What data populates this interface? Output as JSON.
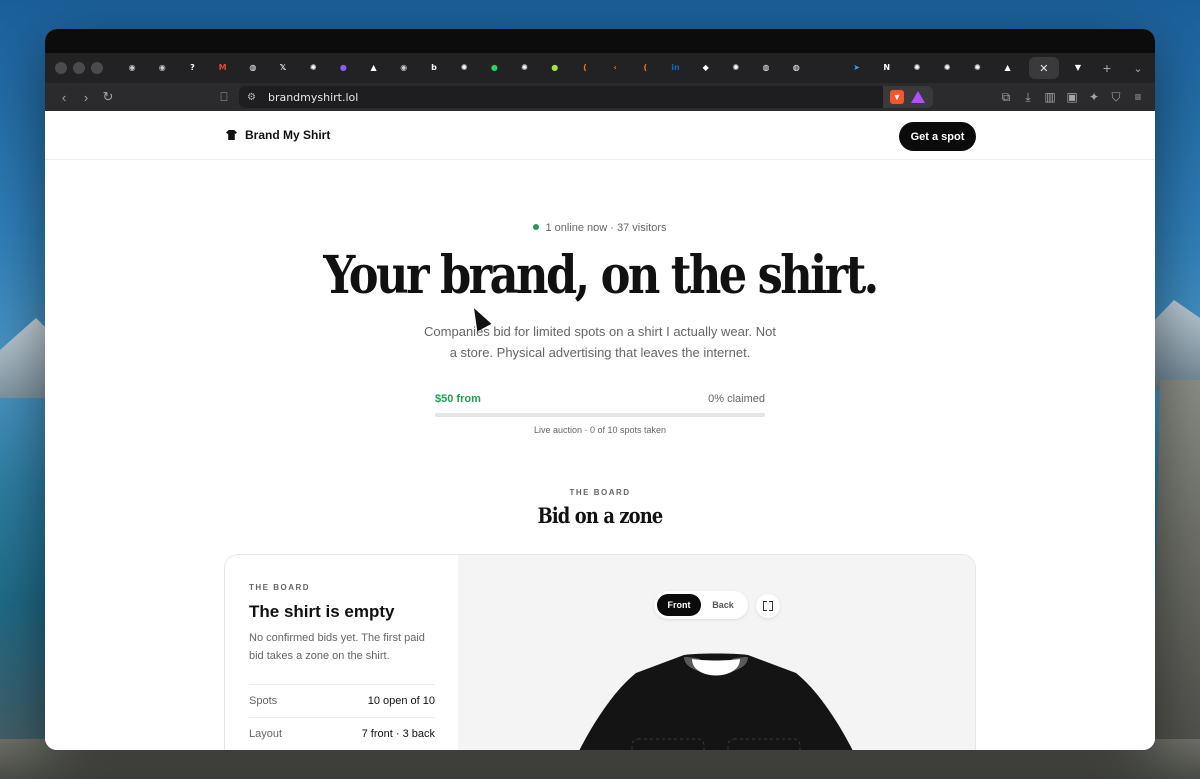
{
  "browser": {
    "url": "brandmyshirt.lol",
    "tabs": [
      {
        "icon": "globe-icon",
        "glyph": "◉",
        "color": "#cfcfd2"
      },
      {
        "icon": "globe-icon",
        "glyph": "◉",
        "color": "#cfcfd2"
      },
      {
        "icon": "help-icon",
        "glyph": "?",
        "color": "#ffffff"
      },
      {
        "icon": "gmail-icon",
        "glyph": "M",
        "color": "#ea4335"
      },
      {
        "icon": "github-icon",
        "glyph": "◍",
        "color": "#ffffff"
      },
      {
        "icon": "x-icon",
        "glyph": "𝕏",
        "color": "#ffffff"
      },
      {
        "icon": "chatgpt-icon",
        "glyph": "✺",
        "color": "#ffffff"
      },
      {
        "icon": "purple-app-icon",
        "glyph": "●",
        "color": "#8b5cf6"
      },
      {
        "icon": "triangle-icon",
        "glyph": "▲",
        "color": "#ffffff"
      },
      {
        "icon": "globe-icon",
        "glyph": "◉",
        "color": "#cfcfd2"
      },
      {
        "icon": "b-icon",
        "glyph": "b",
        "color": "#ffffff"
      },
      {
        "icon": "chatgpt-icon",
        "glyph": "✺",
        "color": "#ffffff"
      },
      {
        "icon": "whatsapp-icon",
        "glyph": "●",
        "color": "#25d366"
      },
      {
        "icon": "chatgpt-icon",
        "glyph": "✺",
        "color": "#ffffff"
      },
      {
        "icon": "green-app-icon",
        "glyph": "●",
        "color": "#a3e635"
      },
      {
        "icon": "orange-bracket-icon",
        "glyph": "(",
        "color": "#f97316"
      },
      {
        "icon": "orange-bracket-icon",
        "glyph": "‹",
        "color": "#f97316"
      },
      {
        "icon": "orange-bracket-icon",
        "glyph": "(",
        "color": "#f97316"
      },
      {
        "icon": "linkedin-icon",
        "glyph": "in",
        "color": "#0a66c2"
      },
      {
        "icon": "box-icon",
        "glyph": "◆",
        "color": "#ffffff"
      },
      {
        "icon": "chatgpt-icon",
        "glyph": "✺",
        "color": "#ffffff"
      },
      {
        "icon": "github-icon",
        "glyph": "◍",
        "color": "#ffffff"
      },
      {
        "icon": "github-icon",
        "glyph": "◍",
        "color": "#ffffff"
      },
      {
        "icon": "blank-icon",
        "glyph": "",
        "color": "#666666"
      },
      {
        "icon": "telegram-icon",
        "glyph": "➤",
        "color": "#2aabee"
      },
      {
        "icon": "notion-icon",
        "glyph": "N",
        "color": "#ffffff"
      },
      {
        "icon": "chatgpt-icon",
        "glyph": "✺",
        "color": "#ffffff"
      },
      {
        "icon": "chatgpt-icon",
        "glyph": "✺",
        "color": "#ffffff"
      },
      {
        "icon": "chatgpt-icon",
        "glyph": "✺",
        "color": "#ffffff"
      },
      {
        "icon": "triangle-icon",
        "glyph": "▲",
        "color": "#ffffff"
      }
    ],
    "active_tab_icon": "close-icon",
    "last_tab_icon": "shirt-icon"
  },
  "site": {
    "brand": "Brand My Shirt",
    "cta": "Get a spot"
  },
  "hero": {
    "presence": "1 online now · 37 visitors",
    "headline": "Your brand, on the shirt.",
    "subhead": "Companies bid for limited spots on a shirt I actually wear. Not a store. Physical advertising that leaves the internet.",
    "price": "$50 from",
    "claimed": "0% claimed",
    "progress": 0,
    "auction_note": "Live auction · 0 of 10 spots taken"
  },
  "board_section": {
    "eyebrow": "THE BOARD",
    "title": "Bid on a zone"
  },
  "board": {
    "eyebrow": "THE BOARD",
    "title": "The shirt is empty",
    "description": "No confirmed bids yet. The first paid bid takes a zone on the shirt.",
    "stats": [
      {
        "label": "Spots",
        "value": "10 open of 10"
      },
      {
        "label": "Layout",
        "value": "7 front · 3 back"
      }
    ],
    "views": [
      "Front",
      "Back"
    ],
    "selected_view": "Front"
  },
  "colors": {
    "accent_green": "#1f9d55",
    "ink": "#111111"
  }
}
